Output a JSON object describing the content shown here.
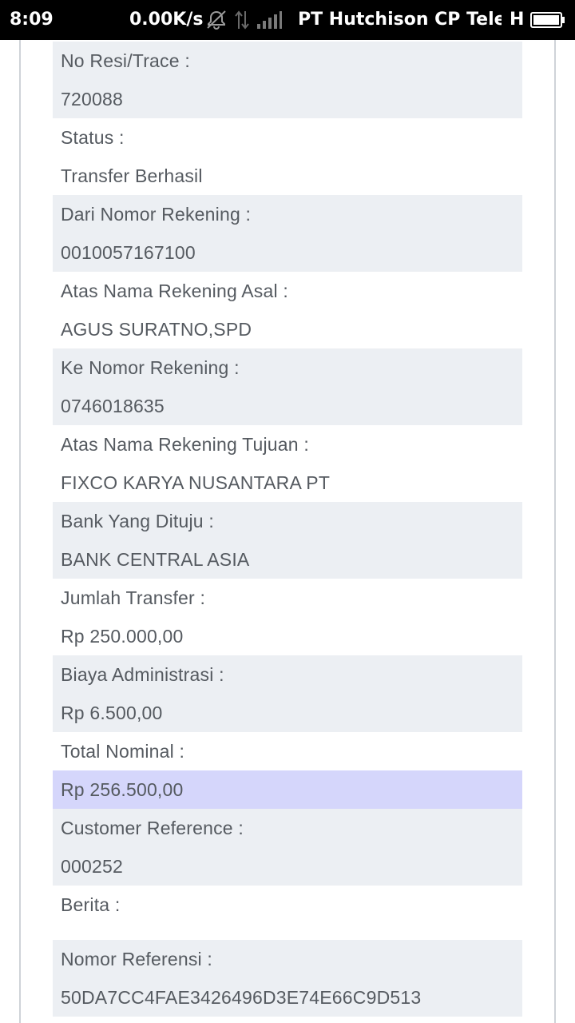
{
  "status_bar": {
    "time": "8:09",
    "speed": "0.00K/s",
    "icons": [
      "vibrate-off-icon",
      "data-arrows-icon",
      "signal-icon"
    ],
    "carrier": "PT Hutchison CP Telecom",
    "network": "H",
    "battery_icon": "battery-icon"
  },
  "colors": {
    "row_shade": "#eceff3",
    "row_highlight": "#d5d6fb",
    "text": "#555a60"
  },
  "details": [
    {
      "label": "No Resi/Trace :",
      "value": "720088"
    },
    {
      "label": "Status :",
      "value": "Transfer Berhasil"
    },
    {
      "label": "Dari Nomor Rekening :",
      "value": "0010057167100"
    },
    {
      "label": "Atas Nama Rekening Asal :",
      "value": "AGUS SURATNO,SPD"
    },
    {
      "label": "Ke Nomor Rekening :",
      "value": "0746018635"
    },
    {
      "label": "Atas Nama Rekening Tujuan :",
      "value": "FIXCO KARYA NUSANTARA PT"
    },
    {
      "label": "Bank Yang Dituju :",
      "value": "BANK CENTRAL ASIA"
    },
    {
      "label": "Jumlah Transfer :",
      "value": "Rp 250.000,00"
    },
    {
      "label": "Biaya Administrasi :",
      "value": "Rp 6.500,00"
    },
    {
      "label": "Total Nominal :",
      "value": "Rp 256.500,00"
    },
    {
      "label": "Customer Reference :",
      "value": "000252"
    },
    {
      "label": "Berita :",
      "value": ""
    },
    {
      "label": "Nomor Referensi :",
      "value": "50DA7CC4FAE3426496D3E74E66C9D513"
    }
  ]
}
